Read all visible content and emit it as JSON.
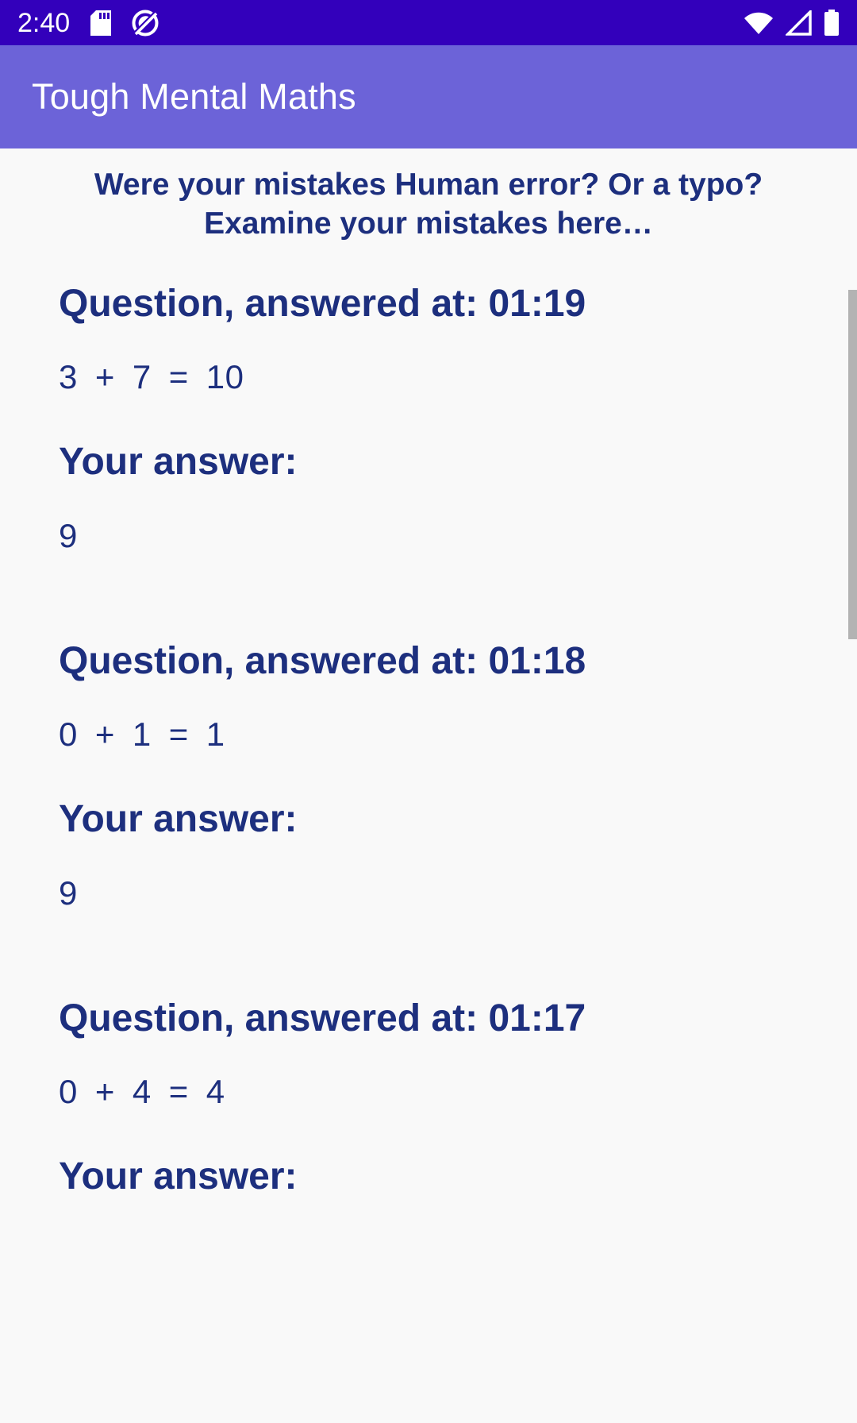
{
  "status_bar": {
    "clock": "2:40",
    "background": "#3300bb",
    "left_icons": [
      "sd-card-icon",
      "do-not-disturb-icon"
    ],
    "right_icons": [
      "wifi-icon",
      "cellular-signal-icon",
      "battery-icon"
    ]
  },
  "app_bar": {
    "title": "Tough Mental Maths",
    "background": "#6c63d8",
    "text_color": "#ffffff"
  },
  "content": {
    "background": "#f9f9f9",
    "accent_color": "#1d2f7e",
    "prompt_line1": "Were your mistakes Human error? Or a typo?",
    "prompt_line2": "Examine your mistakes here…",
    "answer_label": "Your answer:",
    "questions": [
      {
        "title": "Question, answered at: 01:19",
        "operand_left": "3",
        "operator": "+",
        "operand_right": "7",
        "equals": "=",
        "result": "10",
        "your_answer": "9"
      },
      {
        "title": "Question, answered at: 01:18",
        "operand_left": "0",
        "operator": "+",
        "operand_right": "1",
        "equals": "=",
        "result": "1",
        "your_answer": "9"
      },
      {
        "title": "Question, answered at: 01:17",
        "operand_left": "0",
        "operator": "+",
        "operand_right": "4",
        "equals": "=",
        "result": "4",
        "your_answer": ""
      }
    ]
  }
}
